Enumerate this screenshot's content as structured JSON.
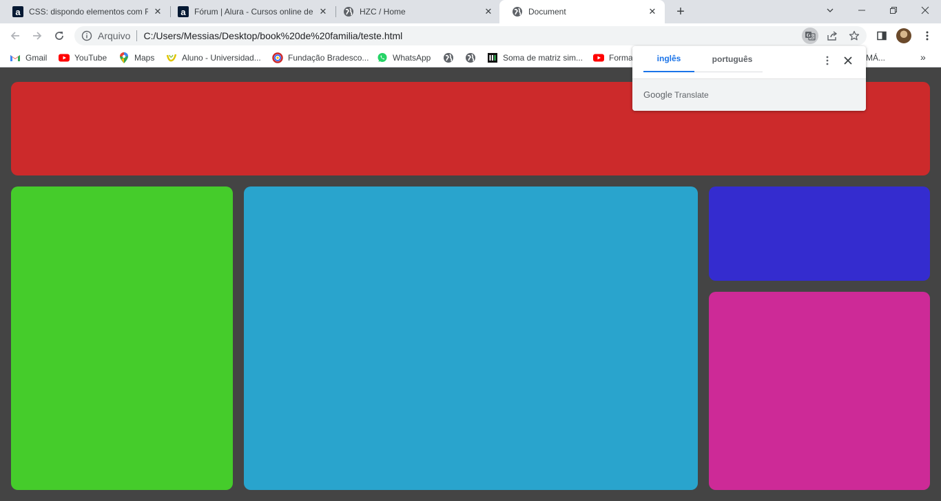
{
  "tabs": [
    {
      "title": "CSS: dispondo elementos com Fl",
      "favicon": "alura-icon",
      "active": false
    },
    {
      "title": "Fórum | Alura - Cursos online de",
      "favicon": "alura-icon",
      "active": false
    },
    {
      "title": "HZC / Home",
      "favicon": "globe-icon",
      "active": false
    },
    {
      "title": "Document",
      "favicon": "globe-icon",
      "active": true
    }
  ],
  "alura_glyph": "a",
  "address_bar": {
    "scheme_label": "Arquivo",
    "url": "C:/Users/Messias/Desktop/book%20de%20familia/teste.html"
  },
  "bookmarks": [
    {
      "label": "Gmail",
      "icon": "gmail-icon"
    },
    {
      "label": "YouTube",
      "icon": "youtube-icon"
    },
    {
      "label": "Maps",
      "icon": "maps-icon"
    },
    {
      "label": "Aluno - Universidad...",
      "icon": "univesp-icon"
    },
    {
      "label": "Fundação Bradesco...",
      "icon": "bradesco-icon"
    },
    {
      "label": "WhatsApp",
      "icon": "whatsapp-icon"
    },
    {
      "label": "",
      "icon": "globe-icon"
    },
    {
      "label": "",
      "icon": "globe-icon"
    },
    {
      "label": "Soma de matriz sim...",
      "icon": "notion-icon"
    },
    {
      "label": "Forma",
      "icon": "youtube-icon"
    },
    {
      "label": "MÁ...",
      "icon": ""
    }
  ],
  "bookmarks_more": "»",
  "translate_popup": {
    "lang_source": "inglês",
    "lang_target": "português",
    "brand_google": "Google",
    "brand_translate": "Translate"
  },
  "colors": {
    "page_background": "#444444",
    "box_red": "#cc2a2b",
    "box_green": "#45cc2b",
    "box_blue": "#29a4cd",
    "box_indigo": "#342ccf",
    "box_magenta": "#cd2a97",
    "accent": "#1a73e8"
  }
}
